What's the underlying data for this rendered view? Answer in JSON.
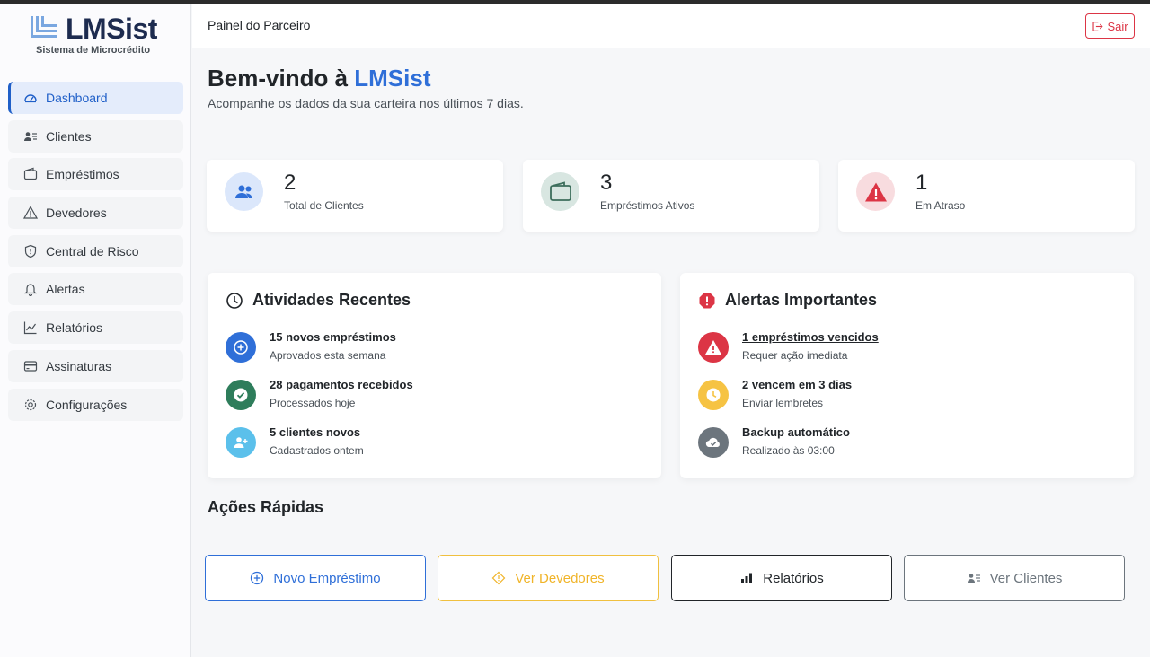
{
  "brand": {
    "name": "LMSist",
    "subtitle": "Sistema de Microcrédito"
  },
  "sidebar": {
    "items": [
      {
        "label": "Dashboard",
        "icon": "dashboard-icon",
        "active": true
      },
      {
        "label": "Clientes",
        "icon": "clients-icon"
      },
      {
        "label": "Empréstimos",
        "icon": "wallet-icon"
      },
      {
        "label": "Devedores",
        "icon": "warning-icon"
      },
      {
        "label": "Central de Risco",
        "icon": "shield-icon"
      },
      {
        "label": "Alertas",
        "icon": "bell-icon"
      },
      {
        "label": "Relatórios",
        "icon": "chart-line-icon"
      },
      {
        "label": "Assinaturas",
        "icon": "credit-card-icon"
      },
      {
        "label": "Configurações",
        "icon": "gear-icon"
      }
    ]
  },
  "header": {
    "title": "Painel do Parceiro",
    "logout_label": "Sair"
  },
  "welcome": {
    "prefix": "Bem-vindo à",
    "brand": "LMSist",
    "subtitle": "Acompanhe os dados da sua carteira nos últimos 7 dias."
  },
  "stats": [
    {
      "value": "2",
      "label": "Total de Clientes"
    },
    {
      "value": "3",
      "label": "Empréstimos Ativos"
    },
    {
      "value": "1",
      "label": "Em Atraso"
    }
  ],
  "activities": {
    "title": "Atividades Recentes",
    "items": [
      {
        "title": "15 novos empréstimos",
        "subtitle": "Aprovados esta semana"
      },
      {
        "title": "28 pagamentos recebidos",
        "subtitle": "Processados hoje"
      },
      {
        "title": "5 clientes novos",
        "subtitle": "Cadastrados ontem"
      }
    ]
  },
  "alerts": {
    "title": "Alertas Importantes",
    "items": [
      {
        "title": "1 empréstimos vencidos",
        "subtitle": "Requer ação imediata"
      },
      {
        "title": "2 vencem em 3 dias",
        "subtitle": "Enviar lembretes"
      },
      {
        "title": "Backup automático",
        "subtitle": "Realizado às 03:00"
      }
    ]
  },
  "quick_actions": {
    "title": "Ações Rápidas",
    "buttons": [
      {
        "label": "Novo Empréstimo"
      },
      {
        "label": "Ver Devedores"
      },
      {
        "label": "Relatórios"
      },
      {
        "label": "Ver Clientes"
      }
    ]
  },
  "colors": {
    "primary": "#2f6fd8",
    "danger": "#dc3545",
    "warning": "#f0b429",
    "success": "#2e7d5b",
    "info": "#5bc0eb"
  }
}
